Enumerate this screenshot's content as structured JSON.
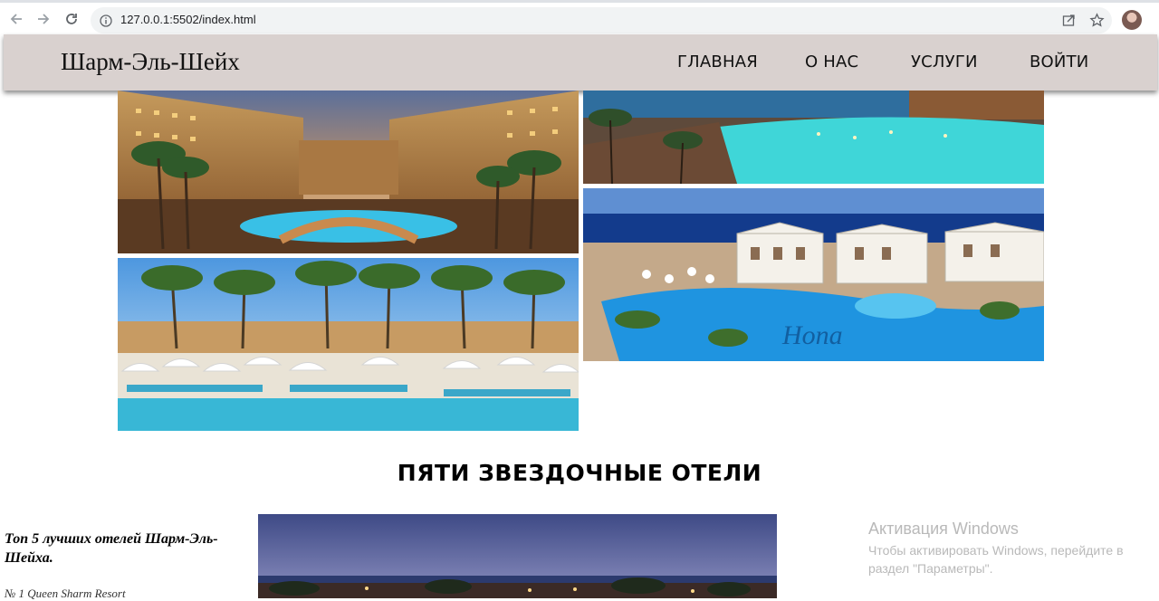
{
  "browser": {
    "url": "127.0.0.1:5502/index.html",
    "icons": [
      "back-arrow-icon",
      "forward-arrow-icon",
      "reload-icon",
      "info-icon",
      "share-icon",
      "star-icon",
      "profile-avatar"
    ]
  },
  "header": {
    "logo": "Шарм-Эль-Шейх",
    "nav": {
      "home": "ГЛАВНАЯ",
      "about": "О НАС",
      "services": "УСЛУГИ",
      "login": "ВОЙТИ"
    },
    "background_color": "#d9d1cf"
  },
  "gallery": {
    "images": [
      "resort-night-photo",
      "pool-evening-photo",
      "beach-umbrellas-photo",
      "white-villas-pool-photo"
    ]
  },
  "section": {
    "title": "ПЯТИ ЗВЕЗДОЧНЫЕ ОТЕЛИ",
    "sidebar_title": "Топ 5 лучших отелей Шарм-Эль-Шейха.",
    "sidebar_item": "№ 1 Queen Sharm Resort"
  },
  "watermark": {
    "title": "Активация Windows",
    "text": "Чтобы активировать Windows, перейдите в раздел \"Параметры\"."
  }
}
